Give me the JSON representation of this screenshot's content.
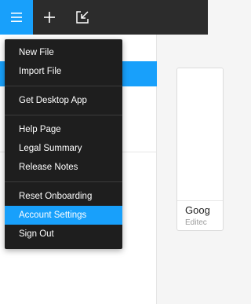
{
  "toolbar": {
    "buttons": [
      {
        "icon": "hamburger-menu-icon"
      },
      {
        "icon": "plus-icon"
      },
      {
        "icon": "import-icon"
      }
    ],
    "accent_color": "#18a0fb",
    "background_color": "#2c2c2c"
  },
  "menu": {
    "groups": [
      [
        "New File",
        "Import File"
      ],
      [
        "Get Desktop App"
      ],
      [
        "Help Page",
        "Legal Summary",
        "Release Notes"
      ],
      [
        "Reset Onboarding",
        "Account Settings",
        "Sign Out"
      ]
    ],
    "active_item": "Account Settings",
    "background_color": "#1e1e1e"
  },
  "file_card": {
    "name": "Goog",
    "meta": "Editec"
  }
}
